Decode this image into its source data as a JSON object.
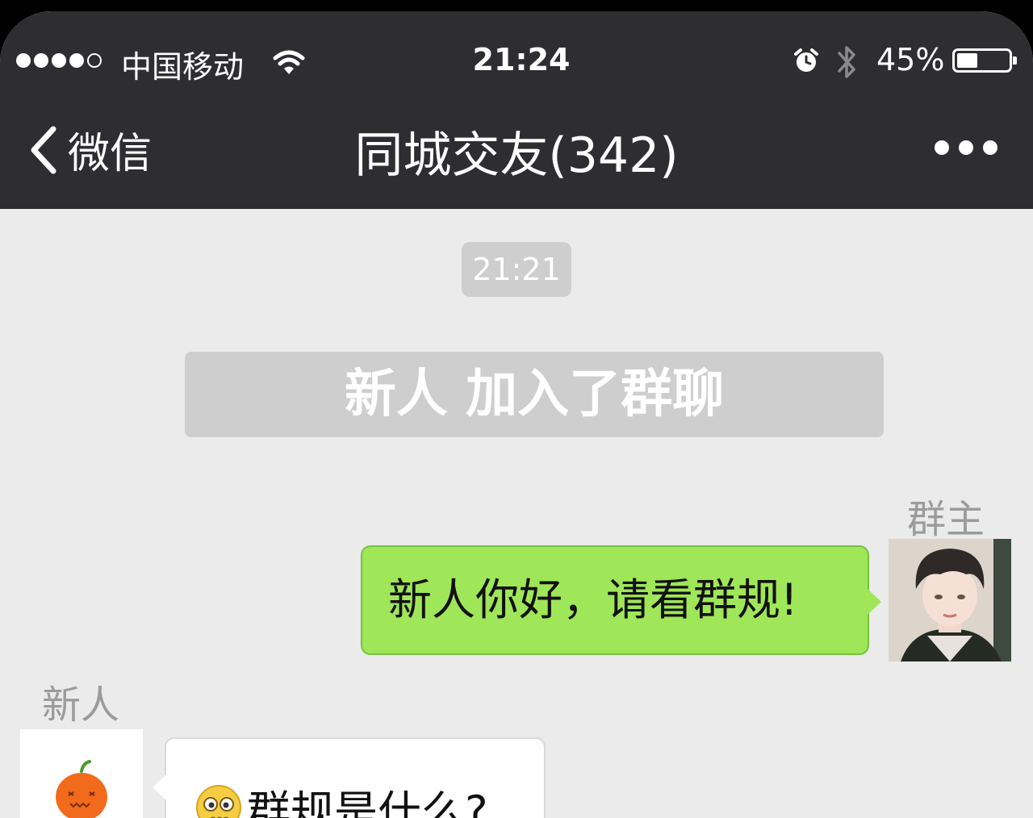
{
  "status_bar": {
    "carrier": "中国移动",
    "signal_strength": 4,
    "signal_total": 5,
    "time": "21:24",
    "battery_percent": "45%",
    "battery_level": 0.45,
    "icons": [
      "wifi-icon",
      "alarm-icon",
      "bluetooth-icon",
      "battery-icon"
    ]
  },
  "nav": {
    "back_label": "微信",
    "title": "同城交友",
    "member_count": "(342)",
    "more_icon": "more-dots-icon"
  },
  "chat": {
    "timestamp": "21:21",
    "system_message": "新人 加入了群聊",
    "messages": [
      {
        "sender": "群主",
        "side": "right",
        "text": "新人你好，请看群规!",
        "avatar_icon": "avatar-owner-photo"
      },
      {
        "sender": "新人",
        "side": "left",
        "text": "群规是什么?",
        "emoji": "worried-face-emoji",
        "avatar_icon": "pumpkin-avatar"
      }
    ]
  },
  "colors": {
    "header_bg": "#2e2e31",
    "chat_bg": "#ebebeb",
    "sent_bubble": "#9fe658",
    "received_bubble": "#ffffff",
    "system_pill": "#cecece"
  }
}
